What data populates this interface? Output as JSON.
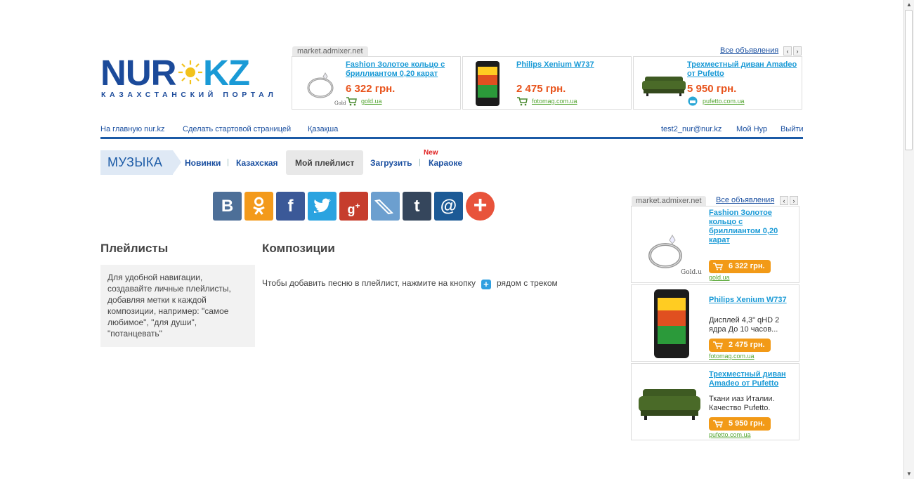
{
  "logo": {
    "word_left": "NUR",
    "word_right": "KZ",
    "subtitle": "КАЗАХСТАНСКИЙ ПОРТАЛ"
  },
  "top_ads": {
    "source": "market.admixer.net",
    "all_link": "Все объявления",
    "items": [
      {
        "title": "Fashion Золотое кольцо с бриллиантом 0,20 карат",
        "price": "6 322 грн.",
        "shop": "gold.ua",
        "image": "ring-image"
      },
      {
        "title": "Philips Xenium W737",
        "price": "2 475 грн.",
        "shop": "fotomag.com.ua",
        "image": "phone-image"
      },
      {
        "title": "Трехместный диван Amadeo от Pufetto",
        "price": "5 950 грн.",
        "shop": "pufetto.com.ua",
        "image": "sofa-image"
      }
    ]
  },
  "nav": {
    "home": "На главную nur.kz",
    "start_page": "Сделать стартовой страницей",
    "lang": "Қазақша",
    "user_email": "test2_nur@nur.kz",
    "my_nur": "Мой Нур",
    "logout": "Выйти"
  },
  "section": {
    "title": "МУЗЫКА",
    "tabs": {
      "new": "Новинки",
      "kazakh": "Казахская",
      "playlist": "Мой плейлист",
      "upload": "Загрузить",
      "karaoke": "Караоке"
    },
    "new_badge": "New"
  },
  "social": {
    "buttons": [
      "vkontakte",
      "odnoklassniki",
      "facebook",
      "twitter",
      "google-plus",
      "livejournal",
      "tumblr",
      "mail-ru",
      "more"
    ]
  },
  "playlists": {
    "heading": "Плейлисты",
    "info": "Для удобной навигации, создавайте личные плейлисты, добавляя метки к каждой композиции, например: \"самое любимое\", \"для души\", \"потанцевать\""
  },
  "compositions": {
    "heading": "Композиции",
    "hint_before": "Чтобы добавить песню в плейлист, нажмите на кнопку",
    "hint_after": "рядом с треком"
  },
  "side_ads": {
    "source": "market.admixer.net",
    "all_link": "Все объявления",
    "items": [
      {
        "title": "Fashion Золотое кольцо с бриллиантом 0,20 карат",
        "desc": "",
        "price": "6 322 грн.",
        "shop": "gold.ua"
      },
      {
        "title": "Philips Xenium W737",
        "desc": "Дисплей 4,3\" qHD 2 ядра До 10 часов...",
        "price": "2 475 грн.",
        "shop": "fotomag.com.ua"
      },
      {
        "title": "Трехместный диван Amadeo от Pufetto",
        "desc": "Ткани иаз Италии. Качество Pufetto.",
        "price": "5 950 грн.",
        "shop": "pufetto.com.ua"
      }
    ]
  },
  "colors": {
    "brand_blue": "#1b5aa6",
    "price_orange": "#e8531c",
    "shop_green": "#55a633"
  }
}
